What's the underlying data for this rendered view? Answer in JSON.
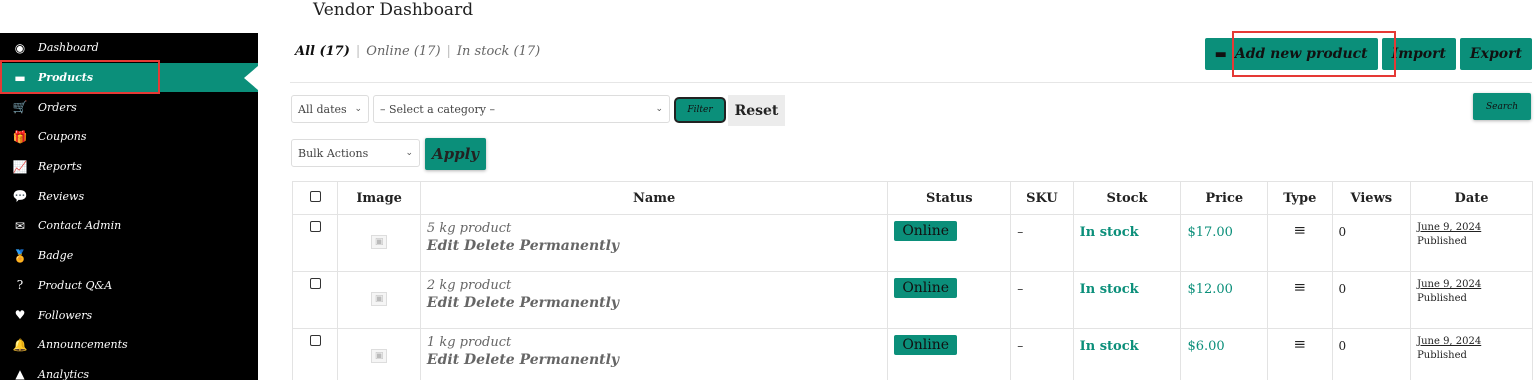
{
  "page_title": "Vendor Dashboard",
  "sidebar": {
    "items": [
      {
        "label": "Dashboard",
        "icon": "tachometer-icon",
        "glyph": "◉",
        "active": false
      },
      {
        "label": "Products",
        "icon": "briefcase-icon",
        "glyph": "▬",
        "active": true
      },
      {
        "label": "Orders",
        "icon": "cart-icon",
        "glyph": "🛒",
        "active": false
      },
      {
        "label": "Coupons",
        "icon": "gift-icon",
        "glyph": "🎁",
        "active": false
      },
      {
        "label": "Reports",
        "icon": "chart-line-icon",
        "glyph": "📈",
        "active": false
      },
      {
        "label": "Reviews",
        "icon": "comments-icon",
        "glyph": "💬",
        "active": false
      },
      {
        "label": "Contact Admin",
        "icon": "envelope-open-icon",
        "glyph": "✉",
        "active": false
      },
      {
        "label": "Badge",
        "icon": "award-icon",
        "glyph": "🏅",
        "active": false
      },
      {
        "label": "Product Q&A",
        "icon": "question-circle-icon",
        "glyph": "?",
        "active": false
      },
      {
        "label": "Followers",
        "icon": "heart-icon",
        "glyph": "♥",
        "active": false
      },
      {
        "label": "Announcements",
        "icon": "bell-icon",
        "glyph": "🔔",
        "active": false
      },
      {
        "label": "Analytics",
        "icon": "chart-area-icon",
        "glyph": "▲",
        "active": false
      }
    ]
  },
  "filters": {
    "all": "All (17)",
    "online": "Online (17)",
    "in_stock": "In stock (17)"
  },
  "actions": {
    "add_new": "Add new product",
    "import": "Import",
    "export": "Export",
    "filter": "Filter",
    "reset": "Reset",
    "search": "Search",
    "apply": "Apply"
  },
  "selects": {
    "dates": "All dates",
    "category": "– Select a category –",
    "bulk": "Bulk Actions"
  },
  "table": {
    "headers": {
      "image": "Image",
      "name": "Name",
      "status": "Status",
      "sku": "SKU",
      "stock": "Stock",
      "price": "Price",
      "type": "Type",
      "views": "Views",
      "date": "Date"
    },
    "rows": [
      {
        "name": "5 kg product",
        "actions": "Edit  Delete Permanently",
        "status": "Online",
        "sku": "–",
        "stock": "In stock",
        "price": "$17.00",
        "views": "0",
        "date": "June 9, 2024",
        "published": "Published"
      },
      {
        "name": "2 kg product",
        "actions": "Edit  Delete Permanently",
        "status": "Online",
        "sku": "–",
        "stock": "In stock",
        "price": "$12.00",
        "views": "0",
        "date": "June 9, 2024",
        "published": "Published"
      },
      {
        "name": "1 kg product",
        "actions": "Edit  Delete Permanently",
        "status": "Online",
        "sku": "–",
        "stock": "In stock",
        "price": "$6.00",
        "views": "0",
        "date": "June 9, 2024",
        "published": "Published"
      }
    ]
  },
  "colors": {
    "accent": "#0b8f7a",
    "sidebar_bg": "#000000",
    "highlight": "#e53935"
  }
}
